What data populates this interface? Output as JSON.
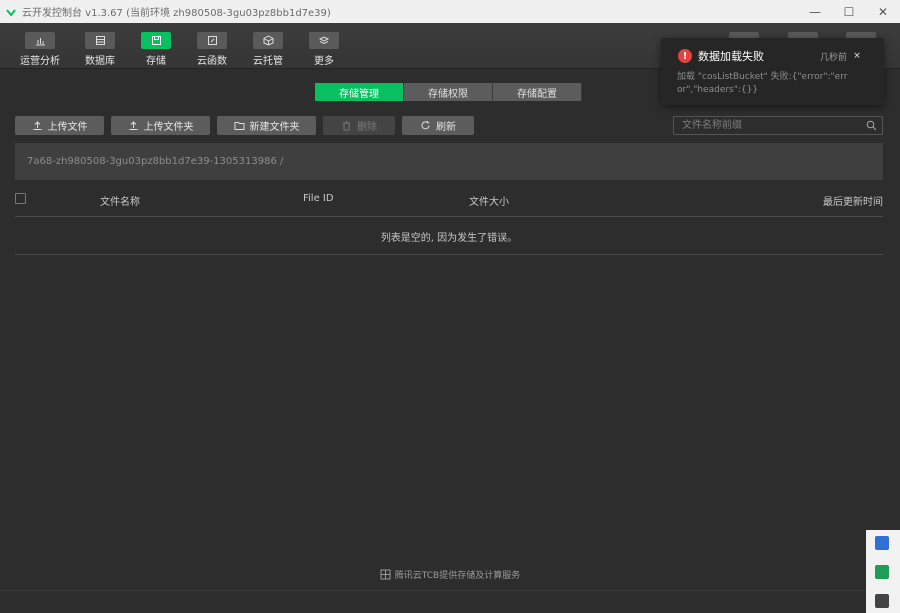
{
  "window": {
    "title": "云开发控制台 v1.3.67 (当前环境 zh980508-3gu03pz8bb1d7e39)",
    "controls": {
      "minimize": "—",
      "maximize": "☐",
      "close": "✕"
    }
  },
  "toolbar": {
    "items": [
      {
        "label": "运营分析",
        "icon": "chart-icon"
      },
      {
        "label": "数据库",
        "icon": "database-icon"
      },
      {
        "label": "存储",
        "icon": "storage-icon",
        "active": true
      },
      {
        "label": "云函数",
        "icon": "function-icon"
      },
      {
        "label": "云托管",
        "icon": "cube-icon"
      },
      {
        "label": "更多",
        "icon": "layers-icon"
      }
    ]
  },
  "tabs": [
    {
      "label": "存储管理",
      "active": true
    },
    {
      "label": "存储权限"
    },
    {
      "label": "存储配置"
    }
  ],
  "actions": {
    "upload_file": "上传文件",
    "upload_folder": "上传文件夹",
    "new_folder": "新建文件夹",
    "delete": "删除",
    "refresh": "刷新"
  },
  "search": {
    "placeholder": "文件名称前缀"
  },
  "path": "7a68-zh980508-3gu03pz8bb1d7e39-1305313986 /",
  "table": {
    "columns": [
      "文件名称",
      "File ID",
      "文件大小",
      "最后更新时间"
    ],
    "empty_text": "列表是空的, 因为发生了错误。"
  },
  "footer": {
    "text": "腾讯云TCB提供存储及计算服务"
  },
  "notification": {
    "title": "数据加载失败",
    "time": "几秒前",
    "message": "加载 \"cosListBucket\" 失败:{\"error\":\"error\",\"headers\":{}}",
    "close": "×"
  },
  "colors": {
    "accent": "#07c160",
    "error": "#e64340"
  }
}
